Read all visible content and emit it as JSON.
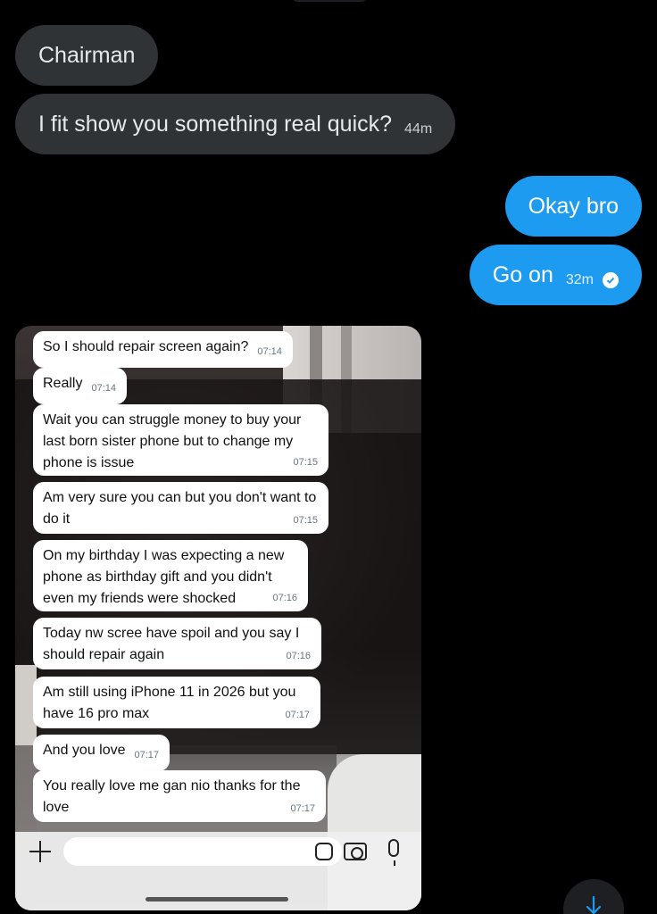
{
  "messages_in": [
    {
      "text": "Chairman",
      "time": ""
    },
    {
      "text": "I fit show you something real quick?",
      "time": "44m"
    }
  ],
  "messages_out": [
    {
      "text": "Okay bro",
      "time": ""
    },
    {
      "text": "Go on",
      "time": "32m"
    }
  ],
  "screenshot_messages": [
    {
      "text": "So I should repair screen again?",
      "time": "07:14"
    },
    {
      "text": "Really",
      "time": "07:14"
    },
    {
      "text": "Wait you can struggle money to buy your last born  sister phone but to change my phone is issue",
      "time": "07:15"
    },
    {
      "text": "Am very sure you can but you don't want to do it",
      "time": "07:15"
    },
    {
      "text": "On my birthday I was expecting a new phone as birthday gift and you didn't even my friends were shocked",
      "time": "07:16"
    },
    {
      "text": "Today nw scree have spoil and you say I should repair again",
      "time": "07:16"
    },
    {
      "text": "Am still using iPhone 11 in 2026 but you have 16 pro max",
      "time": "07:17"
    },
    {
      "text": "And you love",
      "time": "07:17"
    },
    {
      "text": "You really love me gan nio thanks for the love",
      "time": "07:17"
    }
  ],
  "colors": {
    "incoming": "#2f3336",
    "outgoing": "#1d9bf0",
    "background": "#000000"
  },
  "icons": [
    "plus-icon",
    "sticker-icon",
    "camera-icon",
    "microphone-icon",
    "check-circle-icon",
    "arrow-down-icon"
  ]
}
